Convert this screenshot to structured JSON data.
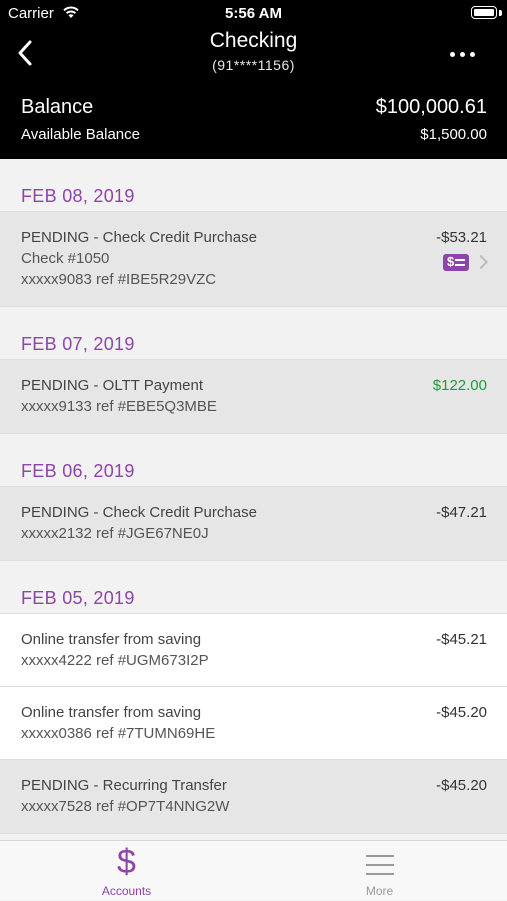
{
  "status_bar": {
    "carrier": "Carrier",
    "time": "5:56 AM"
  },
  "nav": {
    "title": "Checking",
    "account_number": "(91****1156)"
  },
  "balance": {
    "label": "Balance",
    "value": "$100,000.61",
    "available_label": "Available Balance",
    "available_value": "$1,500.00"
  },
  "groups": [
    {
      "date": "FEB 08, 2019",
      "transactions": [
        {
          "description": "PENDING - Check Credit Purchase",
          "line2": "Check #1050",
          "line3": "xxxxx9083 ref #IBE5R29VZC",
          "amount": "-$53.21",
          "pending": true,
          "has_check_image": true
        }
      ]
    },
    {
      "date": "FEB 07, 2019",
      "transactions": [
        {
          "description": "PENDING - OLTT Payment",
          "line2": "xxxxx9133 ref #EBE5Q3MBE",
          "amount": "$122.00",
          "pending": true,
          "credit": true
        }
      ]
    },
    {
      "date": "FEB 06, 2019",
      "transactions": [
        {
          "description": "PENDING - Check Credit Purchase",
          "line2": "xxxxx2132 ref #JGE67NE0J",
          "amount": "-$47.21",
          "pending": true
        }
      ]
    },
    {
      "date": "FEB 05, 2019",
      "transactions": [
        {
          "description": "Online transfer from saving",
          "line2": "xxxxx4222 ref #UGM673I2P",
          "amount": "-$45.21",
          "pending": false
        },
        {
          "description": "Online transfer from saving",
          "line2": "xxxxx0386 ref #7TUMN69HE",
          "amount": "-$45.20",
          "pending": false
        },
        {
          "description": "PENDING - Recurring Transfer",
          "line2": "xxxxx7528 ref #OP7T4NNG2W",
          "amount": "-$45.20",
          "pending": true
        }
      ]
    }
  ],
  "tabbar": {
    "accounts": {
      "label": "Accounts",
      "icon": "$"
    },
    "more": {
      "label": "More"
    }
  },
  "colors": {
    "accent": "#8e44a8",
    "credit": "#1e9b3c",
    "header_bg": "#000000"
  }
}
